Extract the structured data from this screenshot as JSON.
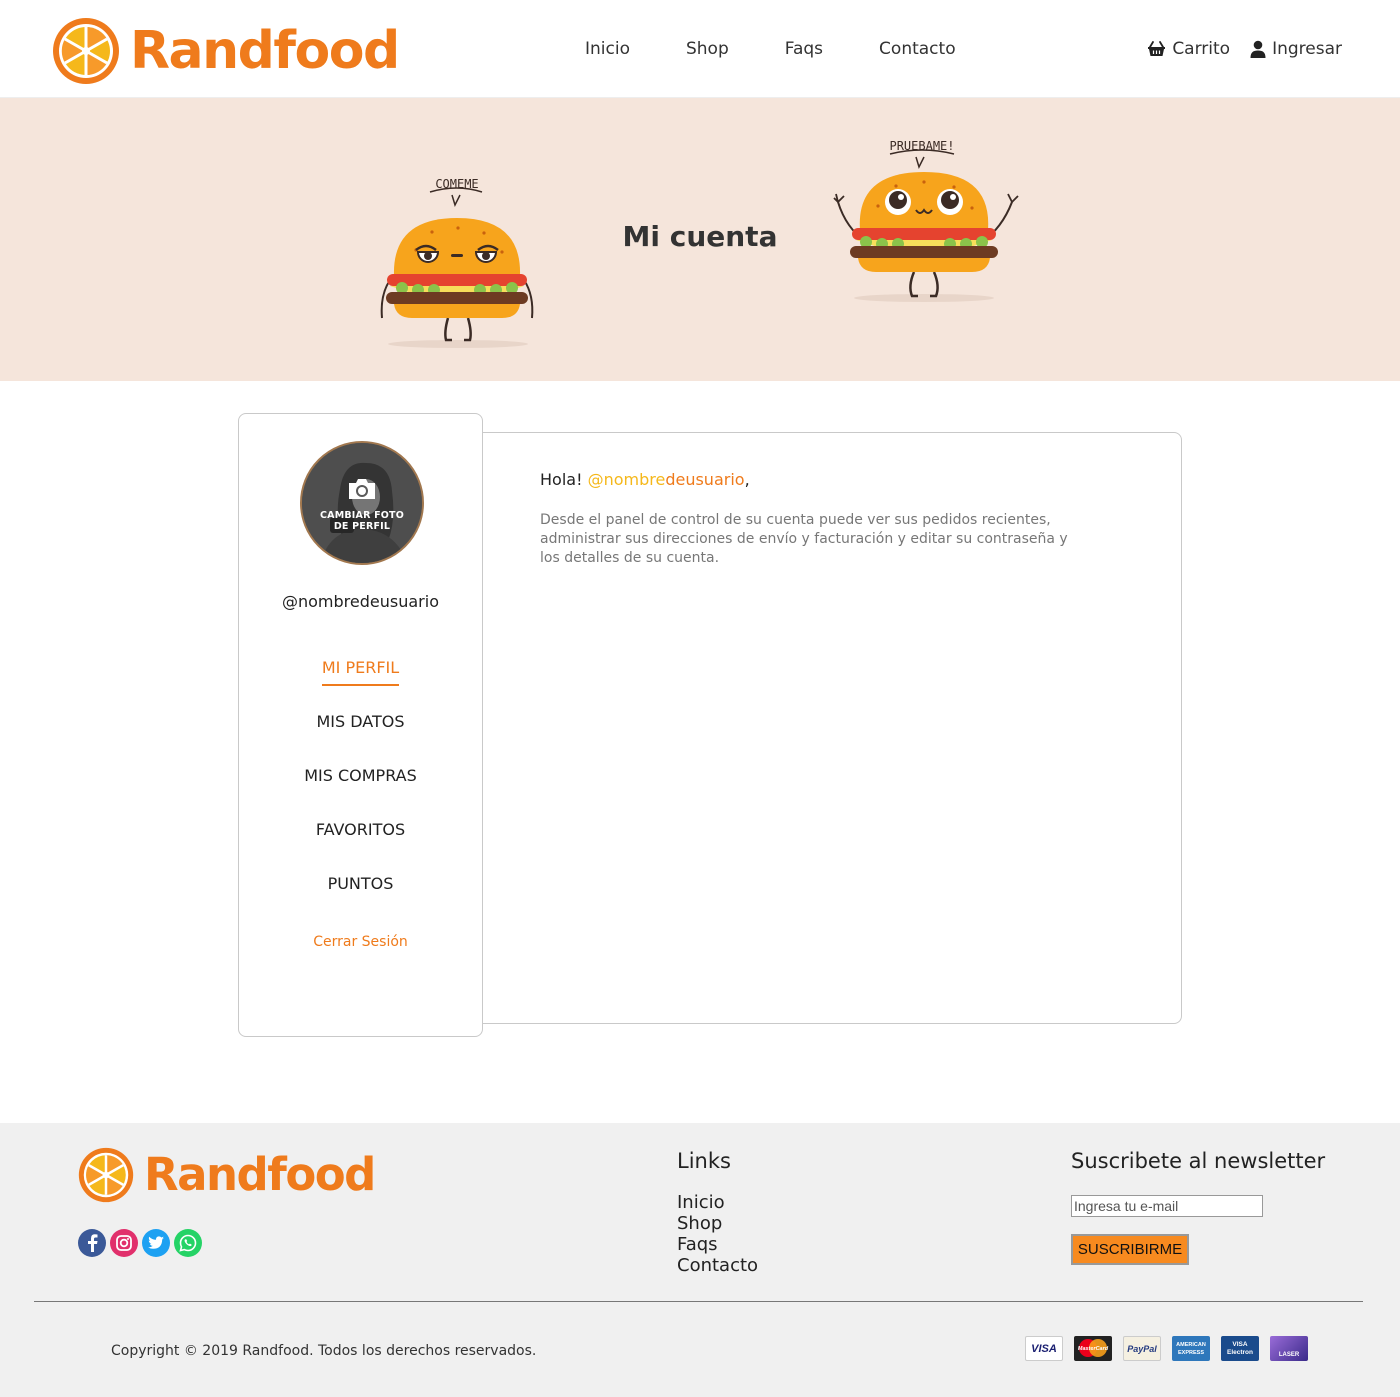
{
  "brand": {
    "name": "Randfood",
    "accent_color": "#ef7b1c",
    "secondary_color": "#f5b81b"
  },
  "header": {
    "nav": [
      {
        "label": "Inicio"
      },
      {
        "label": "Shop"
      },
      {
        "label": "Faqs"
      },
      {
        "label": "Contacto"
      }
    ],
    "cart": {
      "label": "Carrito",
      "icon": "basket-icon"
    },
    "login": {
      "label": "Ingresar",
      "icon": "user-icon"
    }
  },
  "hero": {
    "title": "Mi cuenta",
    "burger_left_speech": "COMEME",
    "burger_right_speech": "PRUEBAME!",
    "background_color": "#f5e5db"
  },
  "sidebar": {
    "avatar_overlay": "CAMBIAR FOTO DE PERFIL",
    "username": "@nombredeusuario",
    "menu": [
      {
        "label": "MI PERFIL",
        "active": true
      },
      {
        "label": "MIS DATOS",
        "active": false
      },
      {
        "label": "MIS COMPRAS",
        "active": false
      },
      {
        "label": "FAVORITOS",
        "active": false
      },
      {
        "label": "PUNTOS",
        "active": false
      }
    ],
    "logout": "Cerrar Sesión"
  },
  "main": {
    "greeting_prefix": "Hola!",
    "greeting_user_part1": "@nombre",
    "greeting_user_part2": "deusuario",
    "greeting_suffix": ",",
    "intro": "Desde el panel de control de su cuenta puede ver sus pedidos recientes, administrar sus direcciones de envío y facturación y editar su contraseña y los detalles de su cuenta."
  },
  "footer": {
    "brand": "Randfood",
    "social": [
      {
        "name": "facebook-icon",
        "color": "#3b5998"
      },
      {
        "name": "instagram-icon",
        "color": "#e1306c"
      },
      {
        "name": "twitter-icon",
        "color": "#1da1f2"
      },
      {
        "name": "whatsapp-icon",
        "color": "#25d366"
      }
    ],
    "links_title": "Links",
    "links": [
      {
        "label": "Inicio"
      },
      {
        "label": "Shop"
      },
      {
        "label": "Faqs"
      },
      {
        "label": "Contacto"
      }
    ],
    "newsletter_title": "Suscribete al newsletter",
    "newsletter_placeholder": "Ingresa tu e-mail",
    "newsletter_button": "SUSCRIBIRME",
    "copyright": "Copyright © 2019 Randfood. Todos los derechos reservados.",
    "payments": [
      {
        "label": "VISA",
        "icon": "visa-icon"
      },
      {
        "label": "MasterCard",
        "icon": "mastercard-icon"
      },
      {
        "label": "PayPal",
        "icon": "paypal-icon"
      },
      {
        "label": "AMERICAN EXPRESS",
        "icon": "amex-icon"
      },
      {
        "label": "VISA Electron",
        "icon": "visa-electron-icon"
      },
      {
        "label": "LASER",
        "icon": "laser-icon"
      }
    ]
  }
}
